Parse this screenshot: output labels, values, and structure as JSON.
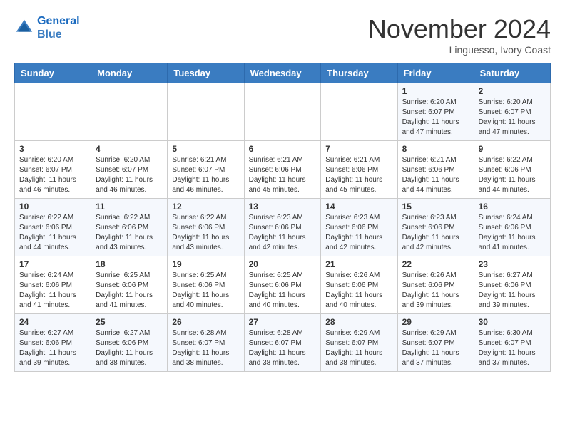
{
  "header": {
    "logo_line1": "General",
    "logo_line2": "Blue",
    "month": "November 2024",
    "location": "Linguesso, Ivory Coast"
  },
  "weekdays": [
    "Sunday",
    "Monday",
    "Tuesday",
    "Wednesday",
    "Thursday",
    "Friday",
    "Saturday"
  ],
  "weeks": [
    [
      {
        "day": "",
        "content": ""
      },
      {
        "day": "",
        "content": ""
      },
      {
        "day": "",
        "content": ""
      },
      {
        "day": "",
        "content": ""
      },
      {
        "day": "",
        "content": ""
      },
      {
        "day": "1",
        "content": "Sunrise: 6:20 AM\nSunset: 6:07 PM\nDaylight: 11 hours\nand 47 minutes."
      },
      {
        "day": "2",
        "content": "Sunrise: 6:20 AM\nSunset: 6:07 PM\nDaylight: 11 hours\nand 47 minutes."
      }
    ],
    [
      {
        "day": "3",
        "content": "Sunrise: 6:20 AM\nSunset: 6:07 PM\nDaylight: 11 hours\nand 46 minutes."
      },
      {
        "day": "4",
        "content": "Sunrise: 6:20 AM\nSunset: 6:07 PM\nDaylight: 11 hours\nand 46 minutes."
      },
      {
        "day": "5",
        "content": "Sunrise: 6:21 AM\nSunset: 6:07 PM\nDaylight: 11 hours\nand 46 minutes."
      },
      {
        "day": "6",
        "content": "Sunrise: 6:21 AM\nSunset: 6:06 PM\nDaylight: 11 hours\nand 45 minutes."
      },
      {
        "day": "7",
        "content": "Sunrise: 6:21 AM\nSunset: 6:06 PM\nDaylight: 11 hours\nand 45 minutes."
      },
      {
        "day": "8",
        "content": "Sunrise: 6:21 AM\nSunset: 6:06 PM\nDaylight: 11 hours\nand 44 minutes."
      },
      {
        "day": "9",
        "content": "Sunrise: 6:22 AM\nSunset: 6:06 PM\nDaylight: 11 hours\nand 44 minutes."
      }
    ],
    [
      {
        "day": "10",
        "content": "Sunrise: 6:22 AM\nSunset: 6:06 PM\nDaylight: 11 hours\nand 44 minutes."
      },
      {
        "day": "11",
        "content": "Sunrise: 6:22 AM\nSunset: 6:06 PM\nDaylight: 11 hours\nand 43 minutes."
      },
      {
        "day": "12",
        "content": "Sunrise: 6:22 AM\nSunset: 6:06 PM\nDaylight: 11 hours\nand 43 minutes."
      },
      {
        "day": "13",
        "content": "Sunrise: 6:23 AM\nSunset: 6:06 PM\nDaylight: 11 hours\nand 42 minutes."
      },
      {
        "day": "14",
        "content": "Sunrise: 6:23 AM\nSunset: 6:06 PM\nDaylight: 11 hours\nand 42 minutes."
      },
      {
        "day": "15",
        "content": "Sunrise: 6:23 AM\nSunset: 6:06 PM\nDaylight: 11 hours\nand 42 minutes."
      },
      {
        "day": "16",
        "content": "Sunrise: 6:24 AM\nSunset: 6:06 PM\nDaylight: 11 hours\nand 41 minutes."
      }
    ],
    [
      {
        "day": "17",
        "content": "Sunrise: 6:24 AM\nSunset: 6:06 PM\nDaylight: 11 hours\nand 41 minutes."
      },
      {
        "day": "18",
        "content": "Sunrise: 6:25 AM\nSunset: 6:06 PM\nDaylight: 11 hours\nand 41 minutes."
      },
      {
        "day": "19",
        "content": "Sunrise: 6:25 AM\nSunset: 6:06 PM\nDaylight: 11 hours\nand 40 minutes."
      },
      {
        "day": "20",
        "content": "Sunrise: 6:25 AM\nSunset: 6:06 PM\nDaylight: 11 hours\nand 40 minutes."
      },
      {
        "day": "21",
        "content": "Sunrise: 6:26 AM\nSunset: 6:06 PM\nDaylight: 11 hours\nand 40 minutes."
      },
      {
        "day": "22",
        "content": "Sunrise: 6:26 AM\nSunset: 6:06 PM\nDaylight: 11 hours\nand 39 minutes."
      },
      {
        "day": "23",
        "content": "Sunrise: 6:27 AM\nSunset: 6:06 PM\nDaylight: 11 hours\nand 39 minutes."
      }
    ],
    [
      {
        "day": "24",
        "content": "Sunrise: 6:27 AM\nSunset: 6:06 PM\nDaylight: 11 hours\nand 39 minutes."
      },
      {
        "day": "25",
        "content": "Sunrise: 6:27 AM\nSunset: 6:06 PM\nDaylight: 11 hours\nand 38 minutes."
      },
      {
        "day": "26",
        "content": "Sunrise: 6:28 AM\nSunset: 6:07 PM\nDaylight: 11 hours\nand 38 minutes."
      },
      {
        "day": "27",
        "content": "Sunrise: 6:28 AM\nSunset: 6:07 PM\nDaylight: 11 hours\nand 38 minutes."
      },
      {
        "day": "28",
        "content": "Sunrise: 6:29 AM\nSunset: 6:07 PM\nDaylight: 11 hours\nand 38 minutes."
      },
      {
        "day": "29",
        "content": "Sunrise: 6:29 AM\nSunset: 6:07 PM\nDaylight: 11 hours\nand 37 minutes."
      },
      {
        "day": "30",
        "content": "Sunrise: 6:30 AM\nSunset: 6:07 PM\nDaylight: 11 hours\nand 37 minutes."
      }
    ]
  ]
}
